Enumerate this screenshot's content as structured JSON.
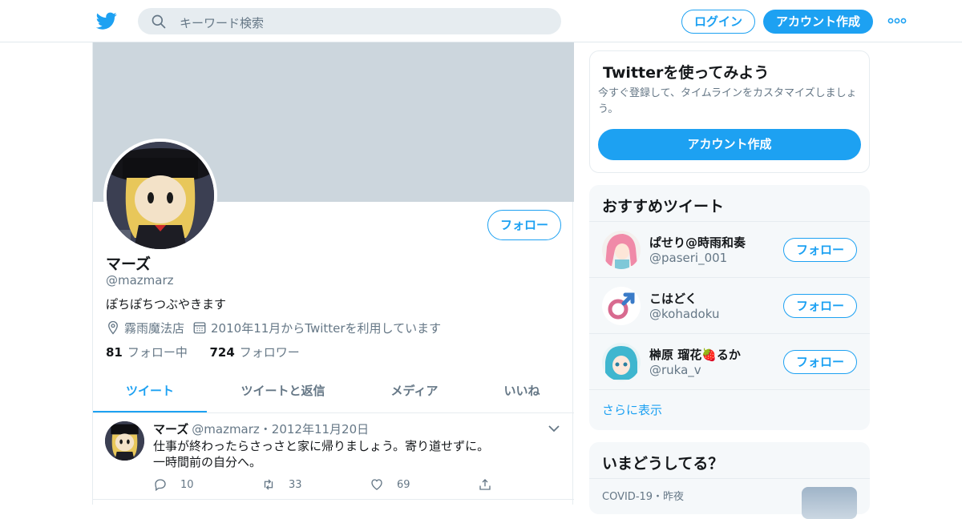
{
  "colors": {
    "accent": "#1da1f2",
    "banner": "#ccd6dd",
    "muted": "#657786"
  },
  "header": {
    "logo_icon": "twitter-bird-icon",
    "search_placeholder": "キーワード検索",
    "login_label": "ログイン",
    "signup_label": "アカウント作成",
    "more_icon": "more-dots-icon"
  },
  "profile": {
    "name": "マーズ",
    "handle": "@mazmarz",
    "bio": "ぽちぽちつぶやきます",
    "location": "霧雨魔法店",
    "joined": "2010年11月からTwitterを利用しています",
    "follow_label": "フォロー",
    "following_count": "81",
    "following_label": "フォロー中",
    "followers_count": "724",
    "followers_label": "フォロワー"
  },
  "tabs": [
    {
      "label": "ツイート",
      "active": true
    },
    {
      "label": "ツイートと返信",
      "active": false
    },
    {
      "label": "メディア",
      "active": false
    },
    {
      "label": "いいね",
      "active": false
    }
  ],
  "tweet": {
    "name": "マーズ",
    "handle_date": "@mazmarz・2012年11月20日",
    "line1": "仕事が終わったらさっさと家に帰りましょう。寄り道せずに。",
    "line2": "一時間前の自分へ。",
    "replies": "10",
    "retweets": "33",
    "likes": "69"
  },
  "sidebar": {
    "signup_card": {
      "title": "Twitterを使ってみよう",
      "subtitle": "今すぐ登録して、タイムラインをカスタマイズしましょう。",
      "button": "アカウント作成"
    },
    "recommend": {
      "title": "おすすめツイート",
      "follow_label": "フォロー",
      "more_label": "さらに表示",
      "users": [
        {
          "name": "ぱせり@時雨和奏",
          "handle": "@paseri_001"
        },
        {
          "name": "こはどく",
          "handle": "@kohadoku"
        },
        {
          "name": "榊原 瑠花🍓るか",
          "handle": "@ruka_v"
        }
      ]
    },
    "trends": {
      "title": "いまどうしてる？",
      "item_meta": "COVID-19・昨夜"
    }
  }
}
